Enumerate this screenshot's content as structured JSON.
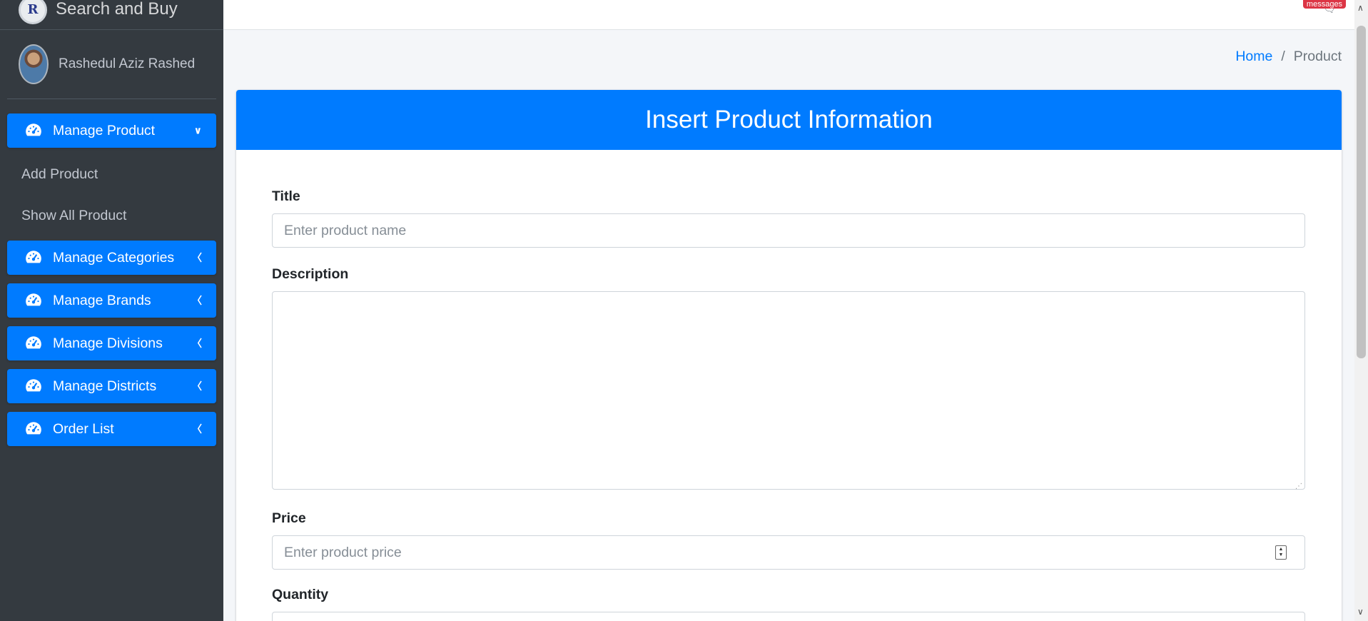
{
  "brand": {
    "logo_letter": "R",
    "title": "Search and Buy"
  },
  "user": {
    "name": "Rashedul Aziz Rashed"
  },
  "sidebar": {
    "manage_product": {
      "label": "Manage Product",
      "icon": "tachometer-icon",
      "expanded": true,
      "subitems": [
        {
          "label": "Add Product"
        },
        {
          "label": "Show All Product"
        }
      ]
    },
    "items": [
      {
        "label": "Manage Categories",
        "icon": "tachometer-icon"
      },
      {
        "label": "Manage Brands",
        "icon": "tachometer-icon"
      },
      {
        "label": "Manage Divisions",
        "icon": "tachometer-icon"
      },
      {
        "label": "Manage Districts",
        "icon": "tachometer-icon"
      },
      {
        "label": "Order List",
        "icon": "tachometer-icon"
      }
    ]
  },
  "topbar": {
    "messages_badge": "messages"
  },
  "breadcrumb": {
    "home": "Home",
    "separator": "/",
    "current": "Product"
  },
  "card": {
    "title": "Insert Product Information"
  },
  "form": {
    "title_label": "Title",
    "title_placeholder": "Enter product name",
    "description_label": "Description",
    "price_label": "Price",
    "price_placeholder": "Enter product price",
    "quantity_label": "Quantity"
  },
  "colors": {
    "primary": "#007bff",
    "sidebar_bg": "#343a40",
    "content_bg": "#f4f6f9",
    "badge": "#dc3545"
  }
}
